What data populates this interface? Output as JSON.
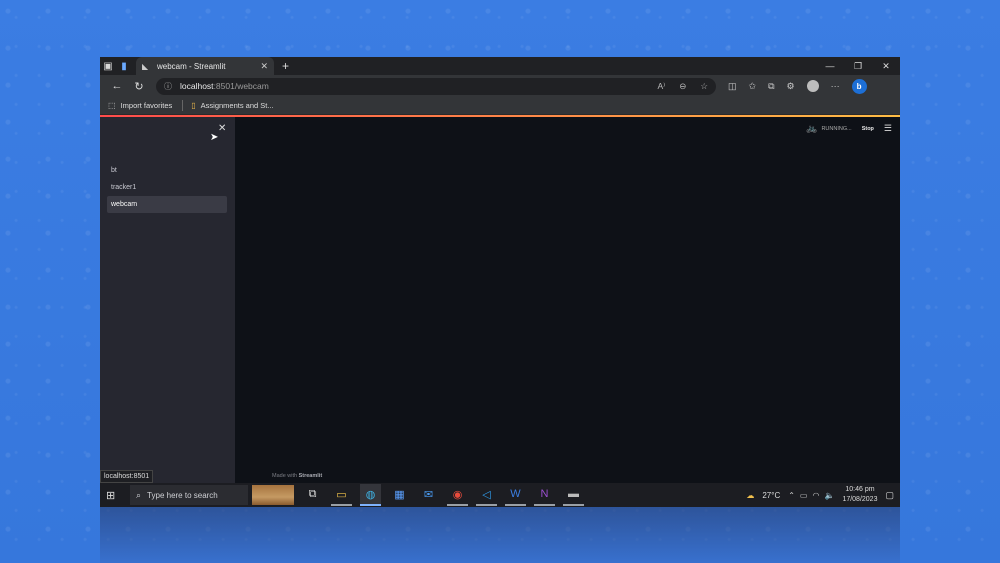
{
  "browser": {
    "tab_title": "webcam - Streamlit",
    "url_host": "localhost",
    "url_path": ":8501/webcam",
    "favorites": [
      {
        "label": "Import favorites"
      },
      {
        "label": "Assignments and St..."
      }
    ],
    "status_url": "localhost:8501"
  },
  "sidebar": {
    "items": [
      {
        "label": "bt"
      },
      {
        "label": "tracker1"
      },
      {
        "label": "webcam"
      }
    ],
    "active_index": 2
  },
  "header": {
    "running_label": "RUNNING...",
    "stop_label": "Stop"
  },
  "footer": {
    "made_with_prefix": "Made with",
    "made_with_brand": "Streamlit"
  },
  "taskbar": {
    "search_placeholder": "Type here to search",
    "temperature": "27°C",
    "time": "10:46 pm",
    "date": "17/08/2023"
  },
  "icons": {
    "tab": "streamlit-icon",
    "apps": [
      "task-view-icon",
      "file-explorer-icon",
      "edge-icon",
      "store-icon",
      "mail-icon",
      "chrome-icon",
      "vscode-icon",
      "word-icon",
      "onenote-icon",
      "terminal-icon"
    ]
  },
  "colors": {
    "streamlit_gradient_start": "#ff4b4b",
    "streamlit_gradient_end": "#ffbd45",
    "app_background": "#0e1117",
    "sidebar_background": "#262730"
  }
}
